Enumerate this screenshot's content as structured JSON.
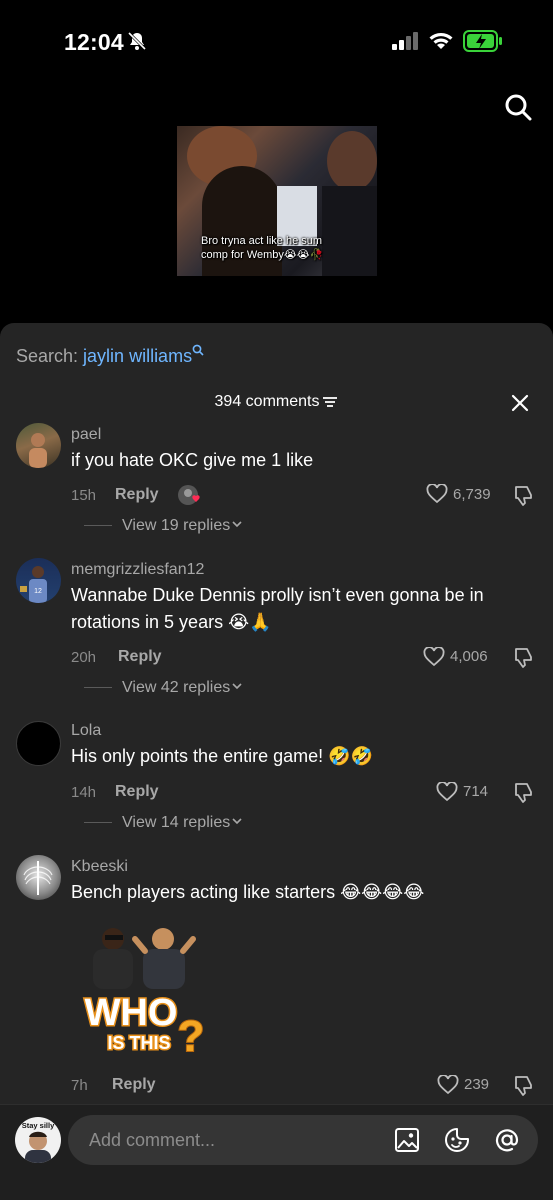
{
  "status": {
    "time": "12:04",
    "icons": [
      "bell-off-icon",
      "signal-icon",
      "wifi-icon",
      "battery-charging-icon"
    ],
    "battery_color": "#3ad33a"
  },
  "video": {
    "caption": "Bro tryna act like he sum comp for Wemby😭😭🥀"
  },
  "sheet": {
    "search_prefix": "Search: ",
    "search_keyword": "jaylin williams",
    "comments_count": "394 comments",
    "accent_color": "#6fb6ff"
  },
  "comments": [
    {
      "username": "pael",
      "text": "if you hate OKC give me 1 like",
      "age": "15h",
      "reply_label": "Reply",
      "likes": "6,739",
      "view_replies": "View 19 replies"
    },
    {
      "username": "memgrizzliesfan12",
      "text": "Wannabe Duke Dennis prolly isn’t even gonna be in rotations in 5 years 😭🙏",
      "age": "20h",
      "reply_label": "Reply",
      "likes": "4,006",
      "view_replies": "View 42 replies"
    },
    {
      "username": "Lola",
      "text": "His only points the entire game! 🤣🤣",
      "age": "14h",
      "reply_label": "Reply",
      "likes": "714",
      "view_replies": "View 14 replies"
    },
    {
      "username": "Kbeeski",
      "text": "Bench players acting like starters 😂😂😂😂",
      "sticker_line1": "WHO",
      "sticker_line2": "IS THIS",
      "age": "7h",
      "reply_label": "Reply",
      "likes": "239"
    }
  ],
  "bottom": {
    "avatar_badge": "Stay silly",
    "input_placeholder": "Add comment...",
    "icons": [
      "image-icon",
      "emoji-icon",
      "mention-icon"
    ]
  }
}
